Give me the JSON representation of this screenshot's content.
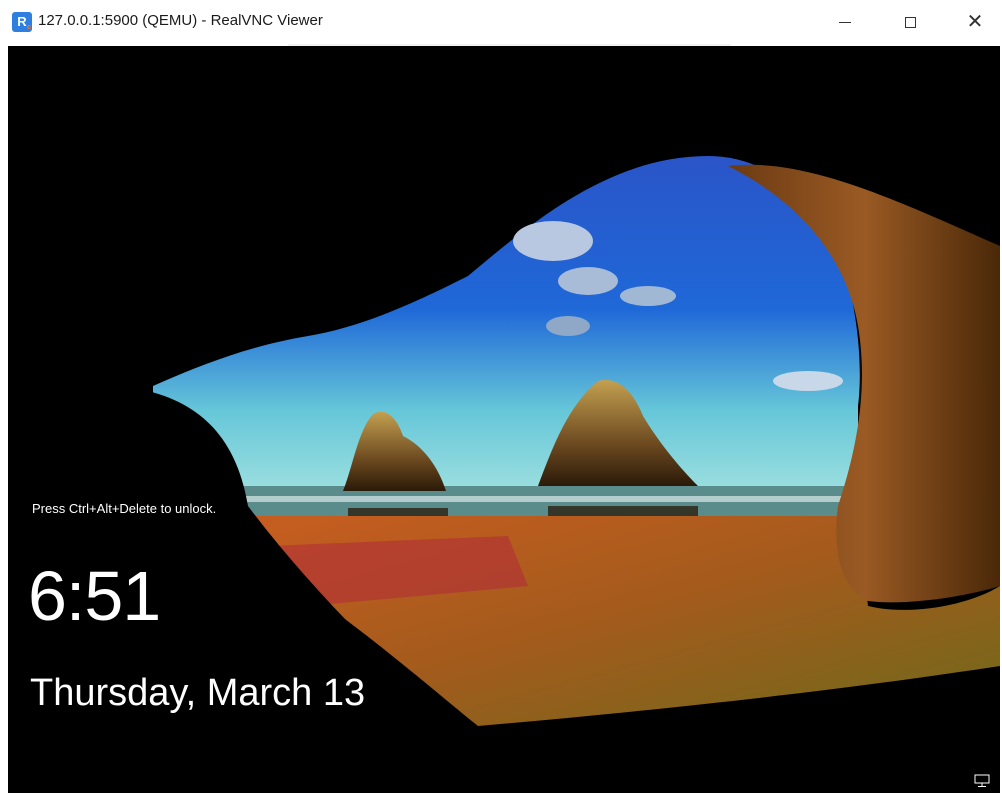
{
  "window": {
    "title": "127.0.0.1:5900 (QEMU) - RealVNC Viewer",
    "app_icon": "realvnc-icon",
    "controls": {
      "minimize": "minimize-icon",
      "maximize": "maximize-icon",
      "close": "close-icon"
    }
  },
  "lock_screen": {
    "hint": "Press Ctrl+Alt+Delete to unlock.",
    "time": "6:51",
    "date": "Thursday, March 13",
    "tray_icon": "network-icon",
    "background_description_colors": {
      "sky": "#1f5fc8",
      "sea": "#7fd6d6",
      "sand": "#c0651a",
      "cave": "#000000"
    }
  }
}
